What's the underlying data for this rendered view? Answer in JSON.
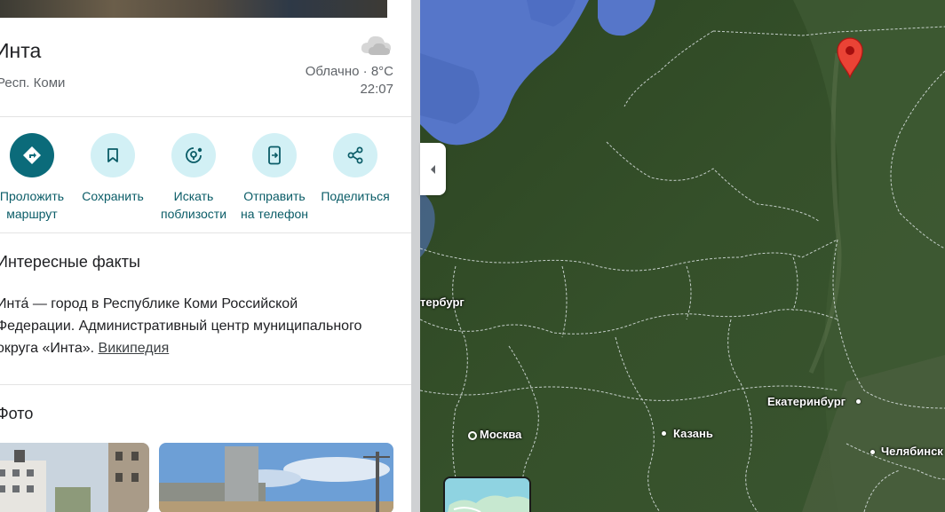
{
  "place": {
    "title": "Инта",
    "region": "Респ. Коми",
    "weather": "Облачно · 8°C",
    "time": "22:07",
    "weather_icon": "cloud-icon"
  },
  "actions": [
    {
      "label": "Проложить\nмаршрут",
      "icon": "directions-icon"
    },
    {
      "label": "Сохранить",
      "icon": "bookmark-icon"
    },
    {
      "label": "Искать\nпоблизости",
      "icon": "nearby-icon"
    },
    {
      "label": "Отправить\nна телефон",
      "icon": "send-to-phone-icon"
    },
    {
      "label": "Поделиться",
      "icon": "share-icon"
    }
  ],
  "facts": {
    "title": "Интересные факты",
    "text": "Инта́ — город в Республике Коми Российской Федерации. Административный центр муниципального округа «Инта».",
    "link": "Википедия"
  },
  "photos": {
    "title": "Фото"
  },
  "map": {
    "cities": {
      "spb": "тербург",
      "moscow": "Москва",
      "kazan": "Казань",
      "ekb": "Екатеринбург",
      "chel": "Челябинск"
    },
    "colors": {
      "water": "#5676c9",
      "forest": "#2f4a25",
      "accent": "#0b6b7a",
      "pin": "#ea4335"
    }
  }
}
